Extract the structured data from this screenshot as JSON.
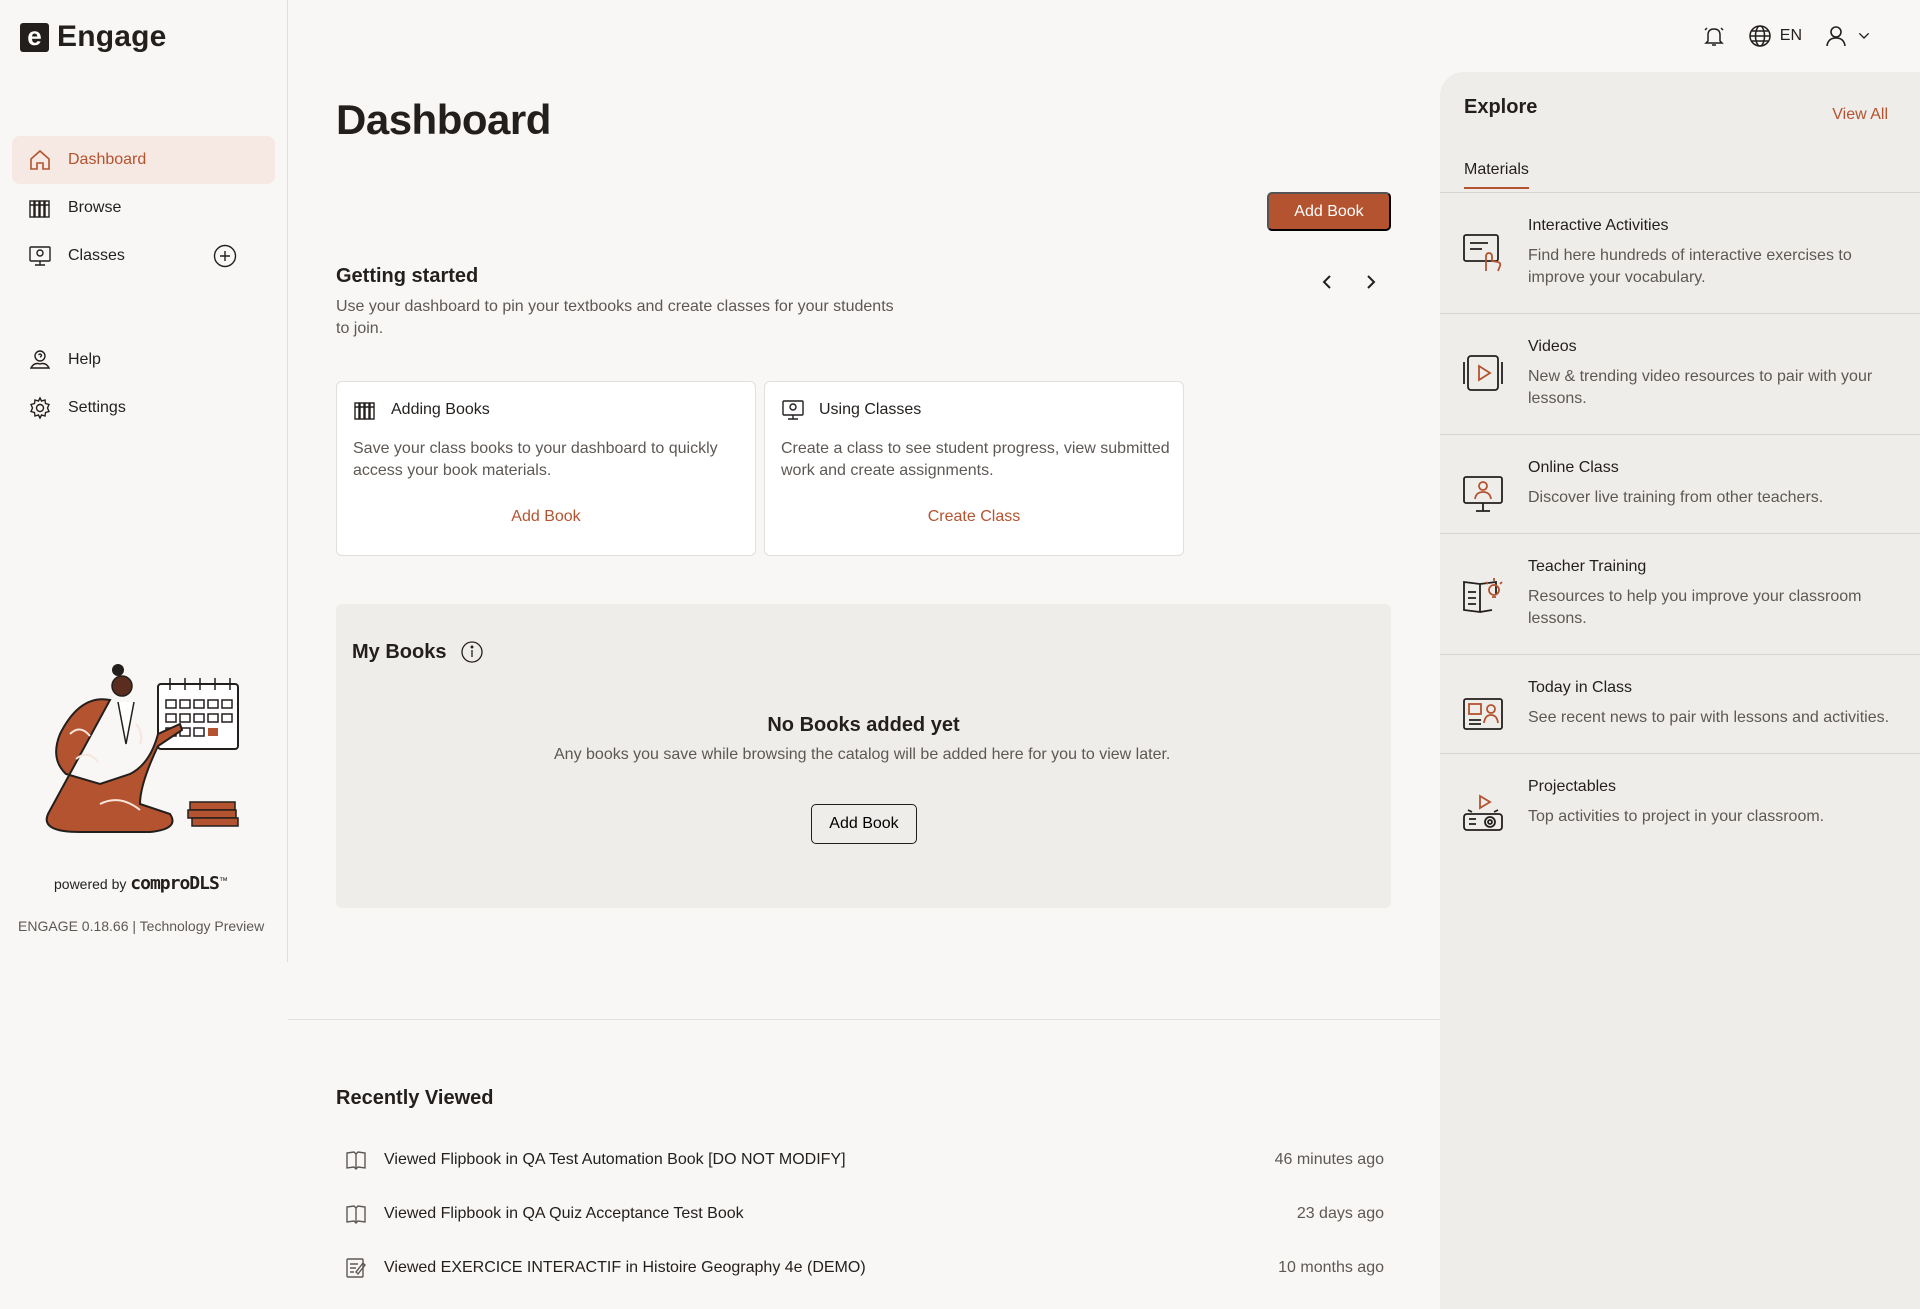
{
  "app": {
    "logo_letter": "e",
    "name": "Engage"
  },
  "header": {
    "language": "EN"
  },
  "sidebar": {
    "items": [
      {
        "label": "Dashboard",
        "icon": "home-icon",
        "active": true
      },
      {
        "label": "Browse",
        "icon": "books-icon"
      },
      {
        "label": "Classes",
        "icon": "class-icon"
      }
    ],
    "secondary": [
      {
        "label": "Help",
        "icon": "help-icon"
      },
      {
        "label": "Settings",
        "icon": "gear-icon"
      }
    ],
    "powered_prefix": "powered by",
    "powered_brand": "comproDLS",
    "powered_tm": "™",
    "version": "ENGAGE 0.18.66 | Technology Preview"
  },
  "main": {
    "title": "Dashboard",
    "add_book_label": "Add Book",
    "getting_started": {
      "title": "Getting started",
      "subtitle": "Use your dashboard to pin your textbooks and create classes for your students to join.",
      "cards": [
        {
          "title": "Adding Books",
          "body": "Save your class books to your dashboard to quickly access your book materials.",
          "link": "Add Book"
        },
        {
          "title": "Using Classes",
          "body": "Create a class to see student progress, view submitted work and create assignments.",
          "link": "Create Class"
        }
      ]
    },
    "my_books": {
      "title": "My Books",
      "empty_title": "No Books added yet",
      "empty_text": "Any books you save while browsing the catalog will be added here for you to view later.",
      "button": "Add Book"
    },
    "recently_viewed": {
      "title": "Recently Viewed",
      "items": [
        {
          "verb": "Viewed",
          "item": "Flipbook",
          "prep": "in",
          "book": "QA Test Automation Book [DO NOT MODIFY]",
          "time": "46 minutes ago",
          "icon": "book-open-icon"
        },
        {
          "verb": "Viewed",
          "item": "Flipbook",
          "prep": "in",
          "book": "QA Quiz Acceptance Test Book",
          "time": "23 days ago",
          "icon": "book-open-icon"
        },
        {
          "verb": "Viewed",
          "item": "EXERCICE INTERACTIF",
          "prep": "in",
          "book": "Histoire Geography 4e (DEMO)",
          "time": "10 months ago",
          "icon": "activity-icon"
        }
      ]
    }
  },
  "explore": {
    "title": "Explore",
    "view_all": "View All",
    "tab": "Materials",
    "items": [
      {
        "name": "Interactive Activities",
        "desc": "Find here hundreds of interactive exercises to improve your vocabulary.",
        "icon": "interactive-activities-icon"
      },
      {
        "name": "Videos",
        "desc": "New & trending video resources to pair with your lessons.",
        "icon": "video-icon"
      },
      {
        "name": "Online Class",
        "desc": "Discover live training from other teachers.",
        "icon": "online-class-icon"
      },
      {
        "name": "Teacher Training",
        "desc": "Resources to help you improve your classroom lessons.",
        "icon": "teacher-training-icon"
      },
      {
        "name": "Today in Class",
        "desc": "See recent news to pair with lessons and activities.",
        "icon": "news-icon"
      },
      {
        "name": "Projectables",
        "desc": "Top activities to project in your classroom.",
        "icon": "projector-icon"
      }
    ]
  },
  "colors": {
    "accent": "#b4532f",
    "text": "#231f1d",
    "muted": "#5e5854",
    "panel": "#efedea",
    "background": "#f8f7f5"
  }
}
